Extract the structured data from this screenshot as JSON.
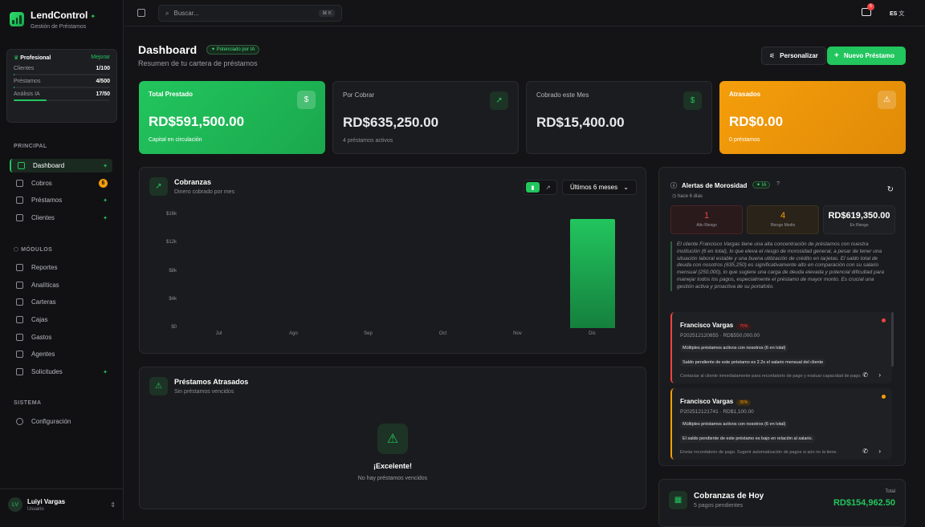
{
  "brand": {
    "name": "LendControl",
    "subtitle": "Gestión de Préstamos"
  },
  "plan": {
    "name": "Profesional",
    "upgrade": "Mejorar",
    "rows": [
      {
        "label": "Clientes",
        "value": "1/100",
        "fill": 0.01
      },
      {
        "label": "Préstamos",
        "value": "4/500",
        "fill": 0.01
      },
      {
        "label": "Análisis IA",
        "value": "17/50",
        "fill": 0.34
      }
    ]
  },
  "nav": {
    "principal_title": "PRINCIPAL",
    "principal": [
      {
        "label": "Dashboard",
        "icon": "dashboard-icon"
      },
      {
        "label": "Cobros",
        "icon": "wallet-icon",
        "badge": "6"
      },
      {
        "label": "Préstamos",
        "icon": "document-icon"
      },
      {
        "label": "Clientes",
        "icon": "users-icon"
      }
    ],
    "modulos_title": "MÓDULOS",
    "modulos": [
      {
        "label": "Reportes",
        "icon": "file-icon"
      },
      {
        "label": "Analíticas",
        "icon": "chart-icon"
      },
      {
        "label": "Carteras",
        "icon": "briefcase-icon"
      },
      {
        "label": "Cajas",
        "icon": "box-icon"
      },
      {
        "label": "Gastos",
        "icon": "receipt-icon"
      },
      {
        "label": "Agentes",
        "icon": "user-plus-icon"
      },
      {
        "label": "Solicitudes",
        "icon": "clipboard-icon"
      }
    ],
    "sistema_title": "SISTEMA",
    "sistema": [
      {
        "label": "Configuración",
        "icon": "gear-icon"
      }
    ]
  },
  "user": {
    "initials": "LV",
    "name": "Luiyi Vargas",
    "role": "Usuario"
  },
  "topbar": {
    "search_placeholder": "Buscar...",
    "shortcut": "⌘ K",
    "notif_count": "5",
    "lang": "ES"
  },
  "header": {
    "title": "Dashboard",
    "ai_pill": "Potenciado por IA",
    "subtitle": "Resumen de tu cartera de préstamos",
    "customize": "Personalizar",
    "new_loan": "Nuevo Préstamo"
  },
  "cards": [
    {
      "label": "Total Prestado",
      "value": "RD$591,500.00",
      "sub": "Capital en circulación"
    },
    {
      "label": "Por Cobrar",
      "value": "RD$635,250.00",
      "sub": "4 préstamos activos"
    },
    {
      "label": "Cobrado este Mes",
      "value": "RD$15,400.00",
      "sub": ""
    },
    {
      "label": "Atrasados",
      "value": "RD$0.00",
      "sub": "0 préstamos"
    }
  ],
  "cobranzas": {
    "title": "Cobranzas",
    "subtitle": "Dinero cobrado por mes",
    "range": "Últimos 6 meses"
  },
  "chart_data": {
    "type": "bar",
    "categories": [
      "Jul",
      "Ago",
      "Sep",
      "Oct",
      "Nov",
      "Dic"
    ],
    "values": [
      0,
      0,
      0,
      0,
      0,
      15400
    ],
    "yticks": [
      "$16k",
      "$12k",
      "$8k",
      "$4k",
      "$0"
    ],
    "ylim": [
      0,
      16000
    ],
    "color": "#22c55e"
  },
  "atrasados": {
    "title": "Préstamos Atrasados",
    "subtitle": "Sin préstamos vencidos",
    "empty_title": "¡Excelente!",
    "empty_sub": "No hay préstamos vencidos"
  },
  "alertas": {
    "title": "Alertas de Morosidad",
    "ai": "IA",
    "time": "hace 6 días",
    "stats": [
      {
        "value": "1",
        "label": "Alto Riesgo"
      },
      {
        "value": "4",
        "label": "Riesgo Medio"
      },
      {
        "value": "RD$619,350.00",
        "label": "En Riesgo"
      }
    ],
    "summary": "El cliente Francisco Vargas tiene una alta concentración de préstamos con nuestra institución (6 en total), lo que eleva el riesgo de morosidad general, a pesar de tener una situación laboral estable y una buena utilización de crédito en tarjetas. El saldo total de deuda con nosotros (635,250) es significativamente alto en comparación con su salario mensual (250,000), lo que sugiere una carga de deuda elevada y potencial dificultad para manejar todos los pagos, especialmente el préstamo de mayor monto. Es crucial una gestión activa y proactiva de su portafolio.",
    "items": [
      {
        "name": "Francisco Vargas",
        "pct": "75%",
        "id": "P202512120855 · RD$550,000.00",
        "flags": [
          "Múltiples préstamos activos con nosotros (6 en total)",
          "Saldo pendiente de este préstamo es 2.2x el salario mensual del cliente"
        ],
        "action": "Contactar al cliente inmediatamente para recordatorio de pago y evaluar capacidad de pago."
      },
      {
        "name": "Francisco Vargas",
        "pct": "35%",
        "id": "P202512121741 · RD$1,100.00",
        "flags": [
          "Múltiples préstamos activos con nosotros (6 en total)",
          "El saldo pendiente de este préstamo es bajo en relación al salario."
        ],
        "action": "Enviar recordatorio de pago. Sugerir automatización de pagos si aún no la tiene."
      }
    ]
  },
  "hoy": {
    "title": "Cobranzas de Hoy",
    "subtitle": "5 pagos pendientes",
    "total_label": "Total",
    "total": "RD$154,962.50"
  }
}
